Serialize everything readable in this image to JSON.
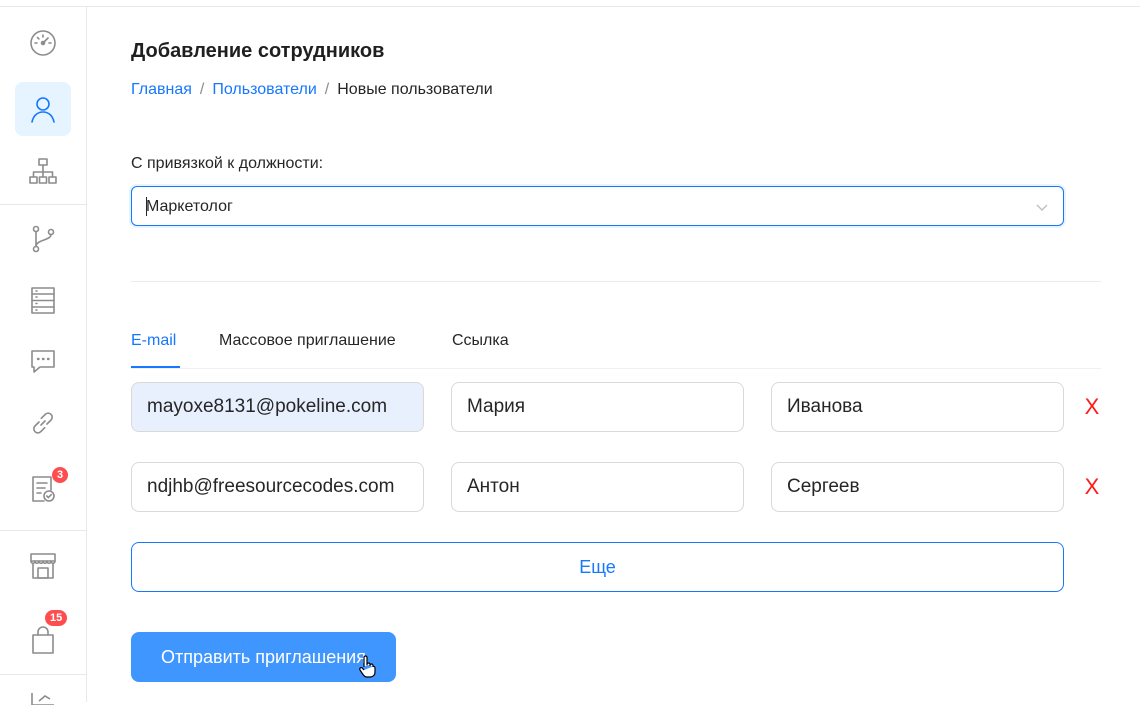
{
  "page": {
    "title": "Добавление сотрудников",
    "breadcrumb": {
      "home": "Главная",
      "users": "Пользователи",
      "current": "Новые пользователи",
      "separator": "/"
    }
  },
  "sidebar": {
    "items": [
      {
        "icon": "dashboard-gauge-icon"
      },
      {
        "icon": "user-icon",
        "active": true
      },
      {
        "icon": "org-structure-icon"
      },
      {
        "icon": "branch-icon"
      },
      {
        "icon": "database-icon"
      },
      {
        "icon": "chat-icon"
      },
      {
        "icon": "link-icon"
      },
      {
        "icon": "tasks-checklist-icon",
        "badge": "3"
      },
      {
        "icon": "store-icon"
      },
      {
        "icon": "shopping-bag-icon",
        "badge": "15"
      }
    ]
  },
  "position": {
    "label": "С привязкой к должности:",
    "value": "Маркетолог"
  },
  "tabs": [
    {
      "label": "E-mail",
      "active": true
    },
    {
      "label": "Массовое приглашение"
    },
    {
      "label": "Ссылка"
    }
  ],
  "invites": [
    {
      "email": "mayoxe8131@pokeline.com",
      "first_name": "Мария",
      "last_name": "Иванова",
      "remove": "X"
    },
    {
      "email": "ndjhb@freesourcecodes.com",
      "first_name": "Антон",
      "last_name": "Сергеев",
      "remove": "X"
    }
  ],
  "buttons": {
    "more": "Еще",
    "submit": "Отправить приглашения"
  },
  "colors": {
    "primary": "#1677ff",
    "submit_bg": "#4096ff",
    "danger": "#ff1a1a",
    "badge": "#ff4d4f",
    "autofill": "#e8f0fe"
  }
}
